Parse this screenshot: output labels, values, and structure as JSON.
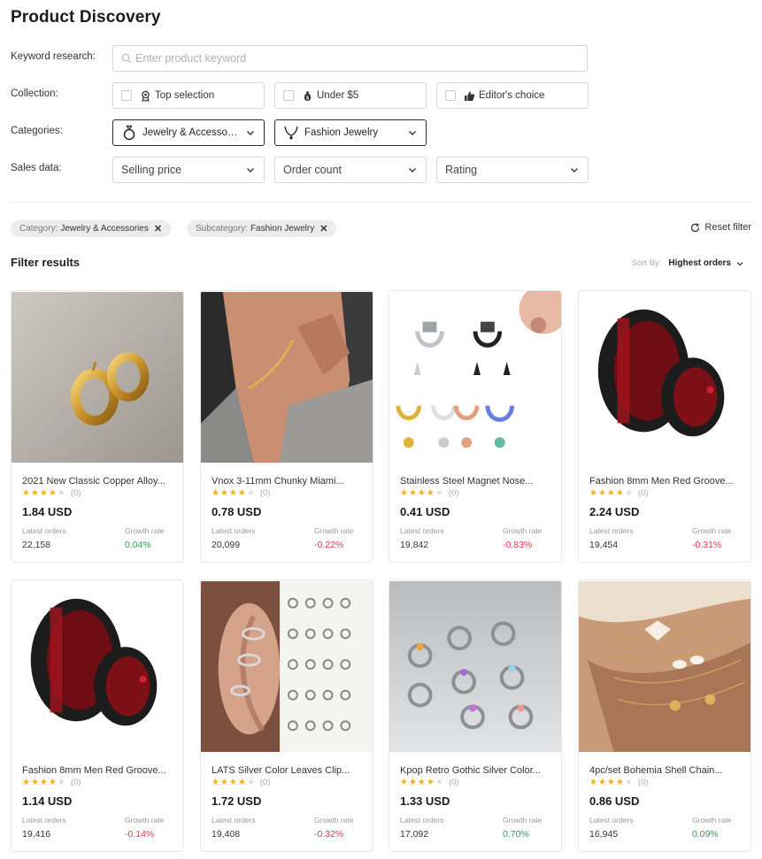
{
  "page_title": "Product Discovery",
  "labels": {
    "keyword": "Keyword research:",
    "collection": "Collection:",
    "categories": "Categories:",
    "sales": "Sales data:"
  },
  "search": {
    "placeholder": "Enter product keyword",
    "value": ""
  },
  "collection": [
    {
      "label": "Top selection",
      "icon": "award-icon",
      "checked": false
    },
    {
      "label": "Under $5",
      "icon": "money-bag-icon",
      "checked": false
    },
    {
      "label": "Editor's choice",
      "icon": "thumbs-up-icon",
      "checked": false
    }
  ],
  "categories": {
    "main": "Jewelry & Accessori...",
    "sub": "Fashion Jewelry"
  },
  "sales": {
    "price": "Selling price",
    "orders": "Order count",
    "rating": "Rating"
  },
  "chips": [
    {
      "key": "Category:",
      "value": "Jewelry & Accessories"
    },
    {
      "key": "Subcategory:",
      "value": "Fashion Jewelry"
    }
  ],
  "reset_label": "Reset filter",
  "results_title": "Filter results",
  "sort": {
    "label": "Sort By:",
    "value": "Highest orders"
  },
  "card_labels": {
    "orders": "Latest orders",
    "growth": "Growth rate"
  },
  "colors": {
    "positive": "#2e9d5a",
    "negative": "#e0394b",
    "star": "#f2b01e"
  },
  "products": [
    {
      "name": "2021 New Classic Copper Alloy...",
      "rating_count": "(0)",
      "price": "1.84 USD",
      "orders": "22,158",
      "growth": "0.04%",
      "trend": "pos",
      "image": "gold-hoop-earrings"
    },
    {
      "name": "Vnox 3-11mm Chunky Miami...",
      "rating_count": "(0)",
      "price": "0.78 USD",
      "orders": "20,099",
      "growth": "-0.22%",
      "trend": "neg",
      "image": "gold-chain-bracelet"
    },
    {
      "name": "Stainless Steel Magnet Nose...",
      "rating_count": "(0)",
      "price": "0.41 USD",
      "orders": "19,842",
      "growth": "-0.83%",
      "trend": "neg",
      "image": "magnet-nose-rings"
    },
    {
      "name": "Fashion 8mm Men Red Groove...",
      "rating_count": "(0)",
      "price": "2.24 USD",
      "orders": "19,454",
      "growth": "-0.31%",
      "trend": "neg",
      "image": "red-black-rings"
    },
    {
      "name": "Fashion 8mm Men Red Groove...",
      "rating_count": "(0)",
      "price": "1.14 USD",
      "orders": "19,416",
      "growth": "-0.14%",
      "trend": "neg",
      "image": "red-black-rings"
    },
    {
      "name": "LATS Silver Color Leaves Clip...",
      "rating_count": "(0)",
      "price": "1.72 USD",
      "orders": "19,408",
      "growth": "-0.32%",
      "trend": "neg",
      "image": "ear-cuffs"
    },
    {
      "name": "Kpop Retro Gothic Silver Color...",
      "rating_count": "(0)",
      "price": "1.33 USD",
      "orders": "17,092",
      "growth": "0.70%",
      "trend": "pos",
      "image": "silver-rings"
    },
    {
      "name": "4pc/set Bohemia Shell Chain...",
      "rating_count": "(0)",
      "price": "0.86 USD",
      "orders": "16,945",
      "growth": "0.09%",
      "trend": "pos",
      "image": "shell-anklet"
    }
  ]
}
